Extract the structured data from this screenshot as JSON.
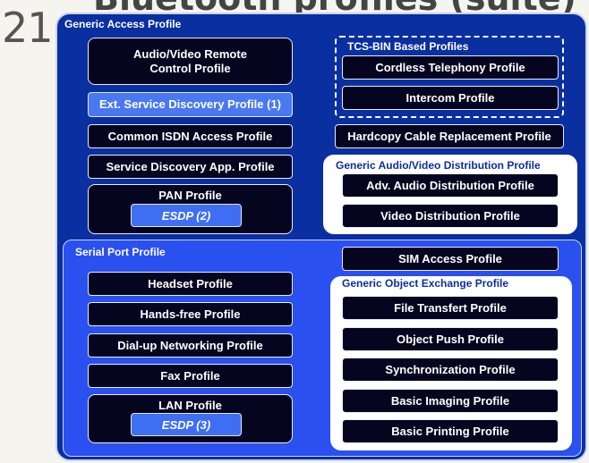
{
  "slide": {
    "number": "21",
    "title": "Bluetooth profiles (suite)"
  },
  "gap": {
    "label": "Generic Access Profile"
  },
  "left_top": {
    "av_remote": "Audio/Video Remote\nControl Profile",
    "ext_sdp": "Ext. Service Discovery Profile (1)",
    "cisdn": "Common ISDN Access Profile",
    "sdap": "Service Discovery App. Profile",
    "pan": "PAN Profile",
    "pan_esdp": "ESDP (2)"
  },
  "tcs": {
    "label": "TCS-BIN Based Profiles",
    "cordless": "Cordless Telephony Profile",
    "intercom": "Intercom Profile"
  },
  "hcrp": "Hardcopy Cable Replacement Profile",
  "gavdp": {
    "label": "Generic Audio/Video Distribution Profile",
    "a2dp": "Adv. Audio Distribution Profile",
    "vdp": "Video Distribution Profile"
  },
  "serial": {
    "label": "Serial Port Profile",
    "headset": "Headset Profile",
    "handsfree": "Hands-free Profile",
    "dun": "Dial-up Networking Profile",
    "fax": "Fax Profile",
    "lan": "LAN Profile",
    "lan_esdp": "ESDP (3)",
    "sim": "SIM Access Profile"
  },
  "goep": {
    "label": "Generic Object Exchange Profile",
    "ftp": "File Transfert Profile",
    "opp": "Object Push Profile",
    "sync": "Synchronization Profile",
    "bip": "Basic Imaging Profile",
    "bpp": "Basic Printing Profile"
  }
}
